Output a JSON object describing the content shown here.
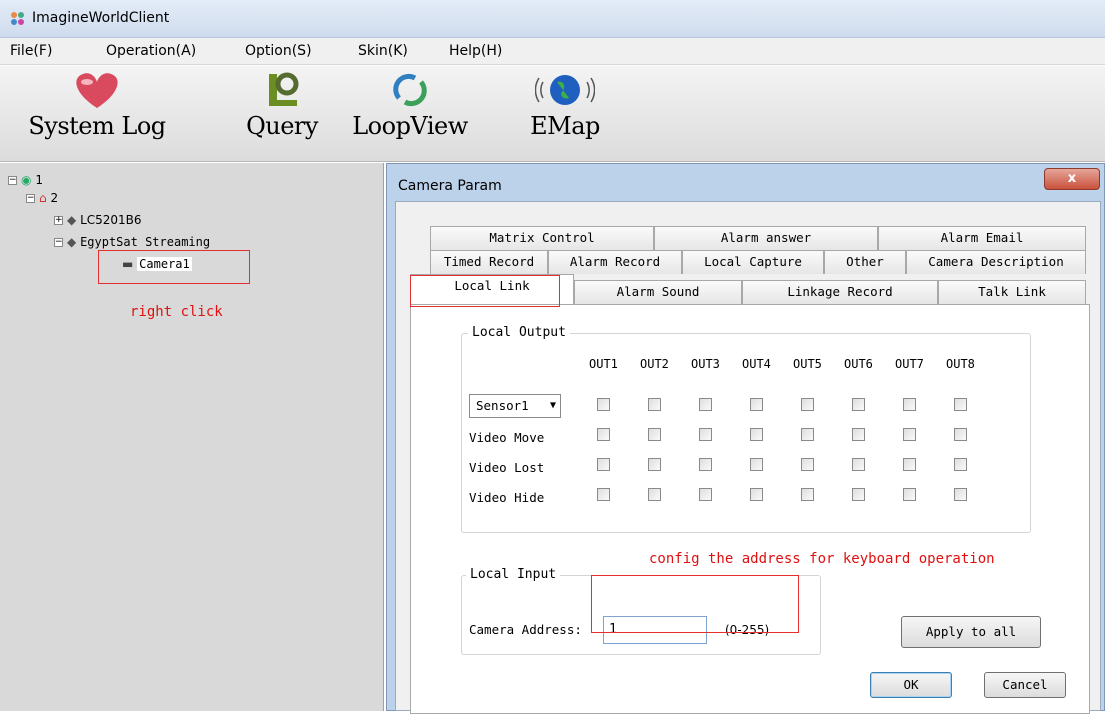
{
  "app": {
    "title": "ImagineWorldClient"
  },
  "menu": [
    "File(F)",
    "Operation(A)",
    "Option(S)",
    "Skin(K)",
    "Help(H)"
  ],
  "toolbar": {
    "items": [
      {
        "label": "System Log",
        "icon": "heart-icon"
      },
      {
        "label": "Query",
        "icon": "query-icon"
      },
      {
        "label": "LoopView",
        "icon": "loop-arrows-icon"
      },
      {
        "label": "EMap",
        "icon": "globe-icon"
      }
    ]
  },
  "tree": {
    "root": "1",
    "node": "2",
    "device1": "LC5201B6",
    "device2": "EgyptSat Streaming",
    "camera": "Camera1",
    "note": "right click"
  },
  "dialog": {
    "title": "Camera Param",
    "close": "x",
    "tabs_row1": [
      "Matrix Control",
      "Alarm answer",
      "Alarm Email"
    ],
    "tabs_row2": [
      "Timed Record",
      "Alarm Record",
      "Local Capture",
      "Other",
      "Camera Description"
    ],
    "tabs_row3": [
      "Local Link",
      "Alarm Sound",
      "Linkage Record",
      "Talk Link"
    ],
    "local_output": {
      "label": "Local Output",
      "columns": [
        "OUT1",
        "OUT2",
        "OUT3",
        "OUT4",
        "OUT5",
        "OUT6",
        "OUT7",
        "OUT8"
      ],
      "sensor_selected": "Sensor1",
      "rows": [
        "Video Move",
        "Video Lost",
        "Video Hide"
      ]
    },
    "note": "config the address for keyboard operation",
    "local_input": {
      "label": "Local Input",
      "address_label": "Camera Address:",
      "address_value": "1",
      "range": "(0-255)"
    },
    "apply_all": "Apply to all",
    "ok": "OK",
    "cancel": "Cancel"
  }
}
